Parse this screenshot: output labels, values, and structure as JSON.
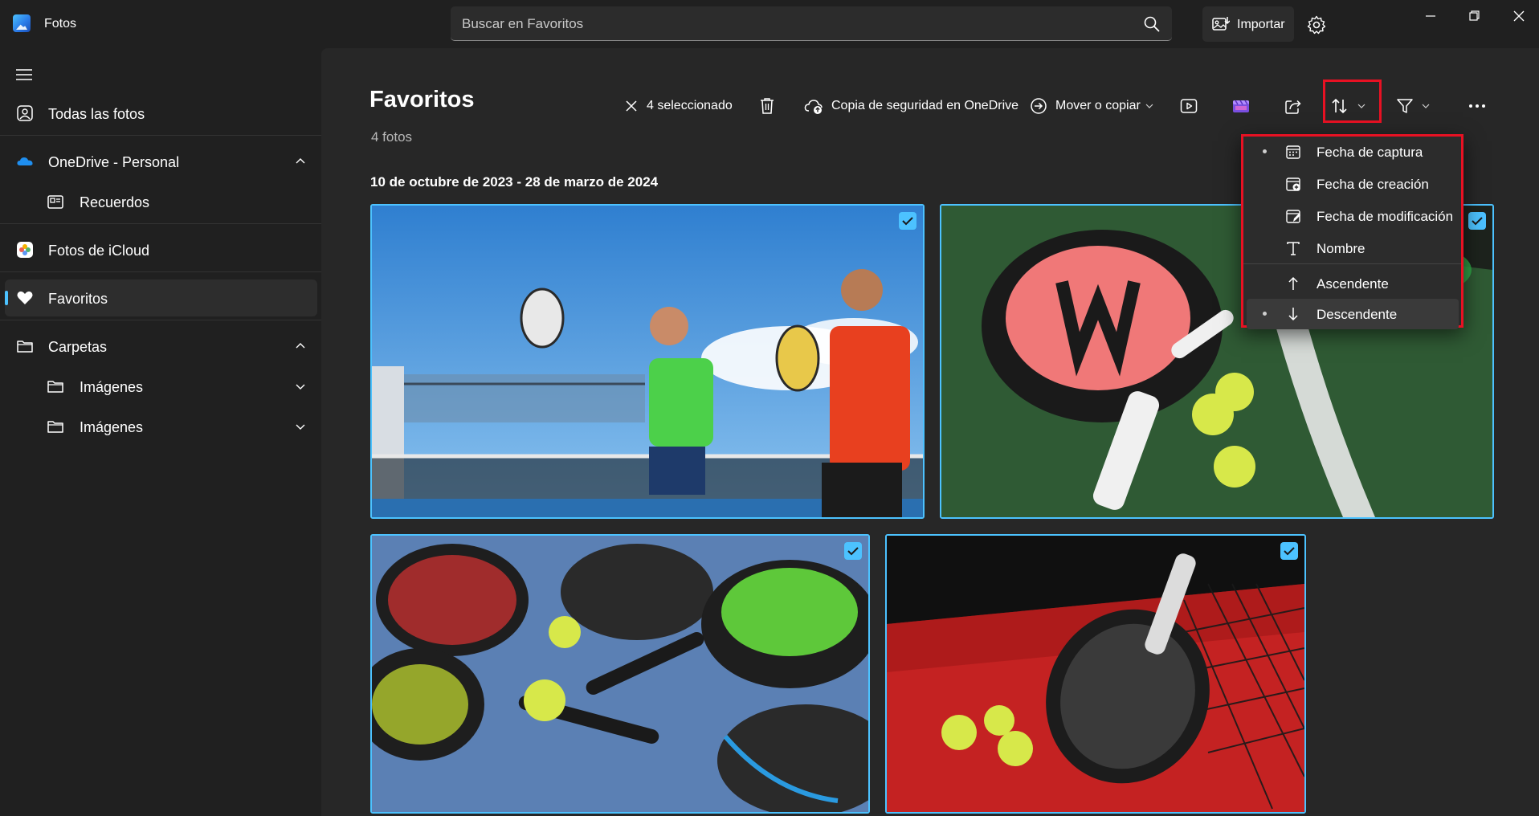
{
  "app": {
    "title": "Fotos"
  },
  "search": {
    "placeholder": "Buscar en Favoritos"
  },
  "header": {
    "import_label": "Importar"
  },
  "sidebar": {
    "items": [
      {
        "label": "Todas las fotos"
      },
      {
        "label": "OneDrive - Personal"
      },
      {
        "label": "Recuerdos"
      },
      {
        "label": "Fotos de iCloud"
      },
      {
        "label": "Favoritos"
      },
      {
        "label": "Carpetas"
      },
      {
        "label": "Imágenes"
      },
      {
        "label": "Imágenes"
      }
    ]
  },
  "main": {
    "title": "Favoritos",
    "count": "4 fotos",
    "date_range": "10 de octubre de 2023 - 28 de marzo de 2024"
  },
  "toolbar": {
    "selected_label": "4 seleccionado",
    "backup_label": "Copia de seguridad en OneDrive",
    "move_label": "Mover o copiar"
  },
  "sort_menu": {
    "items": [
      {
        "label": "Fecha de captura",
        "selected": true
      },
      {
        "label": "Fecha de creación",
        "selected": false
      },
      {
        "label": "Fecha de modificación",
        "selected": false
      },
      {
        "label": "Nombre",
        "selected": false
      },
      {
        "label": "Ascendente",
        "selected": false
      },
      {
        "label": "Descendente",
        "selected": true
      }
    ]
  },
  "photos": [
    {
      "description": "players-net",
      "selected": true
    },
    {
      "description": "racket-grass",
      "selected": true
    },
    {
      "description": "rackets-blue",
      "selected": true
    },
    {
      "description": "racket-red",
      "selected": true
    }
  ],
  "colors": {
    "accent": "#4cc2ff",
    "highlight_border": "#e81123",
    "background": "#202020",
    "content_background": "#272727"
  }
}
